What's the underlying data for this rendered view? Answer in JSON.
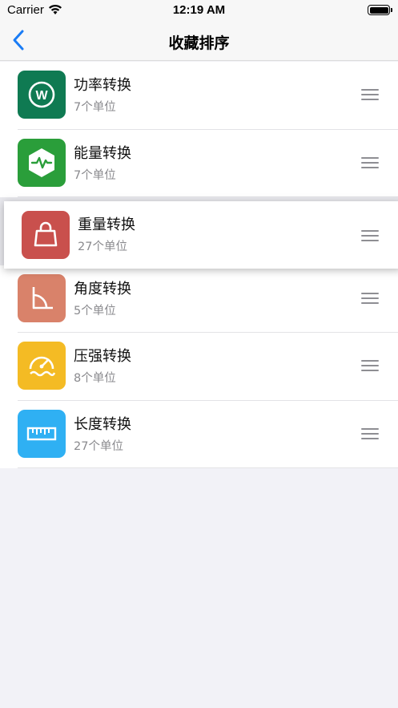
{
  "status_bar": {
    "carrier": "Carrier",
    "time": "12:19 AM"
  },
  "nav": {
    "title": "收藏排序",
    "back_icon": "chevron-left-icon"
  },
  "colors": {
    "power": "#0f7a52",
    "energy": "#2a9e3a",
    "weight": "#c9504d",
    "angle": "#d9826a",
    "pressure": "#f4bb24",
    "length": "#2fb0f3"
  },
  "items": [
    {
      "name": "功率转换",
      "sub": "7个单位",
      "icon": "watt-icon"
    },
    {
      "name": "能量转换",
      "sub": "7个单位",
      "icon": "energy-hexagon-icon"
    },
    {
      "name": "重量转换",
      "sub": "27个单位",
      "icon": "weight-bag-icon"
    },
    {
      "name": "角度转换",
      "sub": "5个单位",
      "icon": "angle-icon"
    },
    {
      "name": "压强转换",
      "sub": "8个单位",
      "icon": "gauge-icon"
    },
    {
      "name": "长度转换",
      "sub": "27个单位",
      "icon": "ruler-icon"
    }
  ]
}
